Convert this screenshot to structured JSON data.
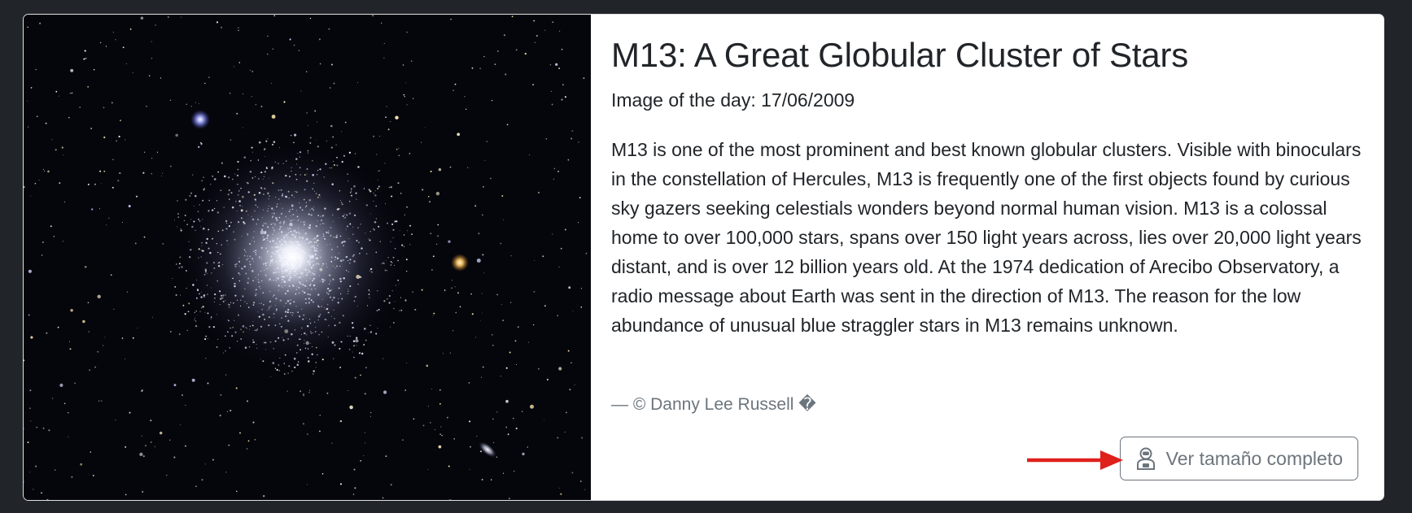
{
  "card": {
    "title": "M13: A Great Globular Cluster of Stars",
    "subtitle": "Image of the day: 17/06/2009",
    "description": "M13 is one of the most prominent and best known globular clusters. Visible with binoculars in the constellation of Hercules, M13 is frequently one of the first objects found by curious sky gazers seeking celestials wonders beyond normal human vision. M13 is a colossal home to over 100,000 stars, spans over 150 light years across, lies over 20,000 light years distant, and is over 12 billion years old. At the 1974 dedication of Arecibo Observatory, a radio message about Earth was sent in the direction of M13. The reason for the low abundance of unusual blue straggler stars in M13 remains unknown.",
    "credit": "— © Danny Lee Russell �",
    "full_size_button": {
      "label": "Ver tamaño completo",
      "icon": "astronaut-icon"
    }
  },
  "colors": {
    "page_background": "#212529",
    "card_background": "#ffffff",
    "text": "#212529",
    "muted": "#6c757d",
    "annotation_arrow": "#e0201b"
  }
}
